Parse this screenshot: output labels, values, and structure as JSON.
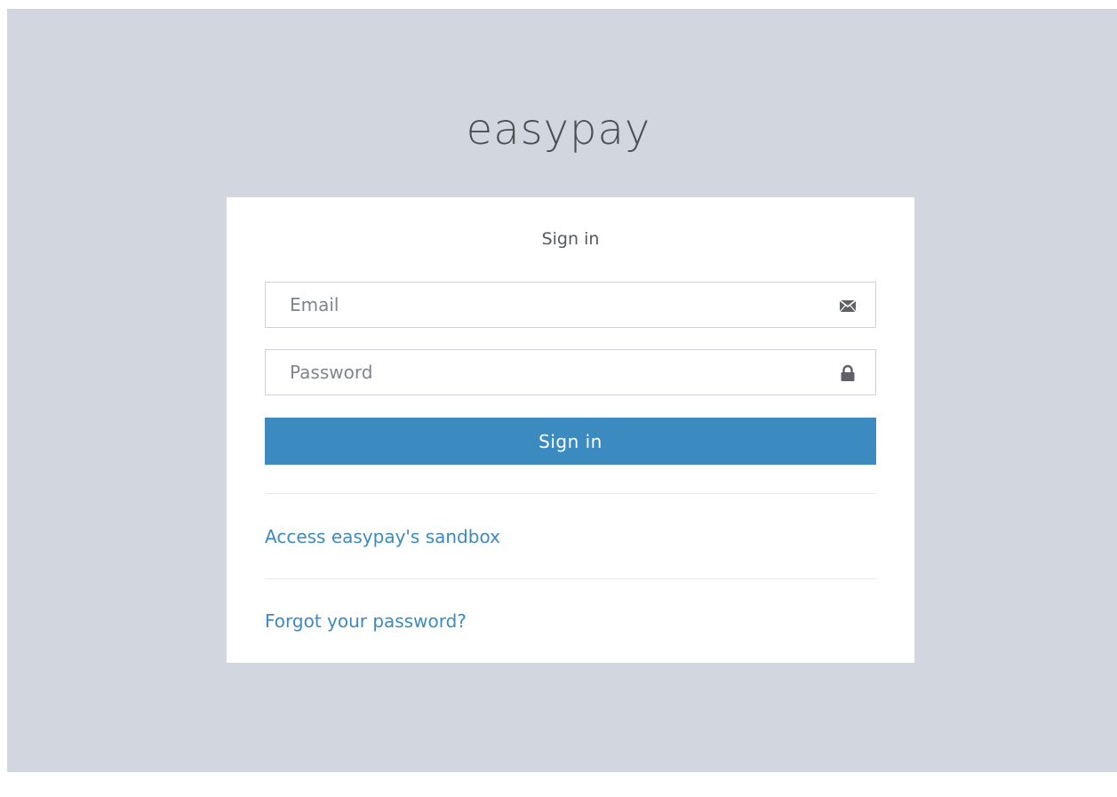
{
  "brand": {
    "logo_text": "easypay"
  },
  "signin": {
    "title": "Sign in",
    "email": {
      "placeholder": "Email",
      "value": "",
      "icon": "envelope-icon"
    },
    "password": {
      "placeholder": "Password",
      "value": "",
      "icon": "lock-icon"
    },
    "submit_label": "Sign in",
    "links": {
      "sandbox": "Access easypay's sandbox",
      "forgot_password": "Forgot your password?"
    }
  },
  "colors": {
    "background": "#d1d6df",
    "card": "#ffffff",
    "accent": "#3b8ac0",
    "logo_text": "#4d4f52"
  }
}
